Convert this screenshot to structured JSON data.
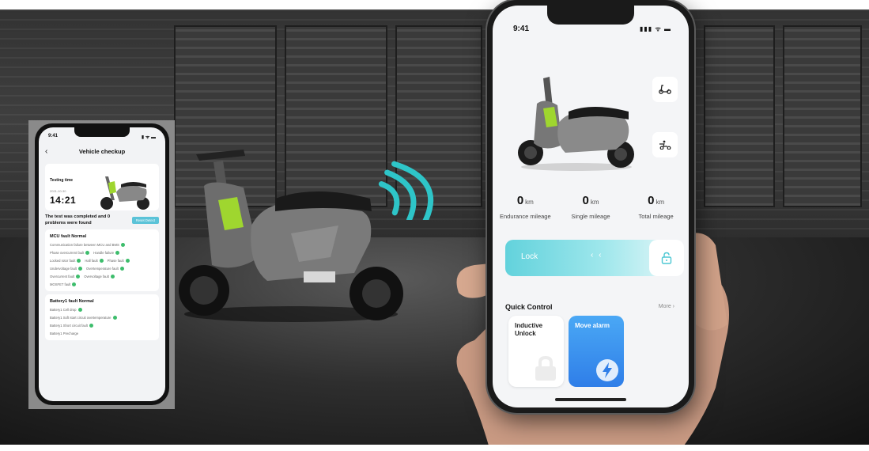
{
  "headline": "",
  "left_phone": {
    "status_time": "9:41",
    "status_icons": "▮ ᯤ ▬",
    "nav_title": "Vehicle checkup",
    "testing_label": "Testing time",
    "test_date": "2021-10-30",
    "test_time": "14:21",
    "result_text": "The test was completed and 0 problems were found",
    "reset_button": "Reset Detect",
    "mcu": {
      "title": "MCU fault Normal",
      "items": [
        "Communication failure between MCU and BMS",
        "Phase overcurrent fault",
        "Handle failure",
        "Locked rotor fault",
        "Hall fault",
        "Phase fault",
        "Undervoltage fault",
        "Overtemperature fault",
        "Overcurrent fault",
        "Overvoltage fault",
        "MOSFET fault"
      ]
    },
    "battery": {
      "title": "Battery1 fault Normal",
      "items": [
        "Battery1 Cell drop",
        "Battery1 Soft start circuit overtemperature",
        "Battery1 Short circuit fault",
        "Battery1 Precharge"
      ]
    }
  },
  "right_phone": {
    "status_time": "9:41",
    "status_icons": "▮▮▮ ᯤ ▬",
    "stats": [
      {
        "value": "0",
        "unit": "km",
        "label": "Endurance mileage"
      },
      {
        "value": "0",
        "unit": "km",
        "label": "Single mileage"
      },
      {
        "value": "0",
        "unit": "km",
        "label": "Total mileage"
      }
    ],
    "lock_label": "Lock",
    "lock_arrows": "‹ ‹",
    "quick_control": "Quick Control",
    "more": "More  ›",
    "cards": [
      {
        "label": "Inductive Unlock"
      },
      {
        "label": "Move alarm"
      }
    ]
  },
  "colors": {
    "accent_teal": "#5bc3d8",
    "ok_green": "#3dbd6c",
    "card_blue": "#2f7ee8",
    "scooter_green": "#9fd62f"
  }
}
